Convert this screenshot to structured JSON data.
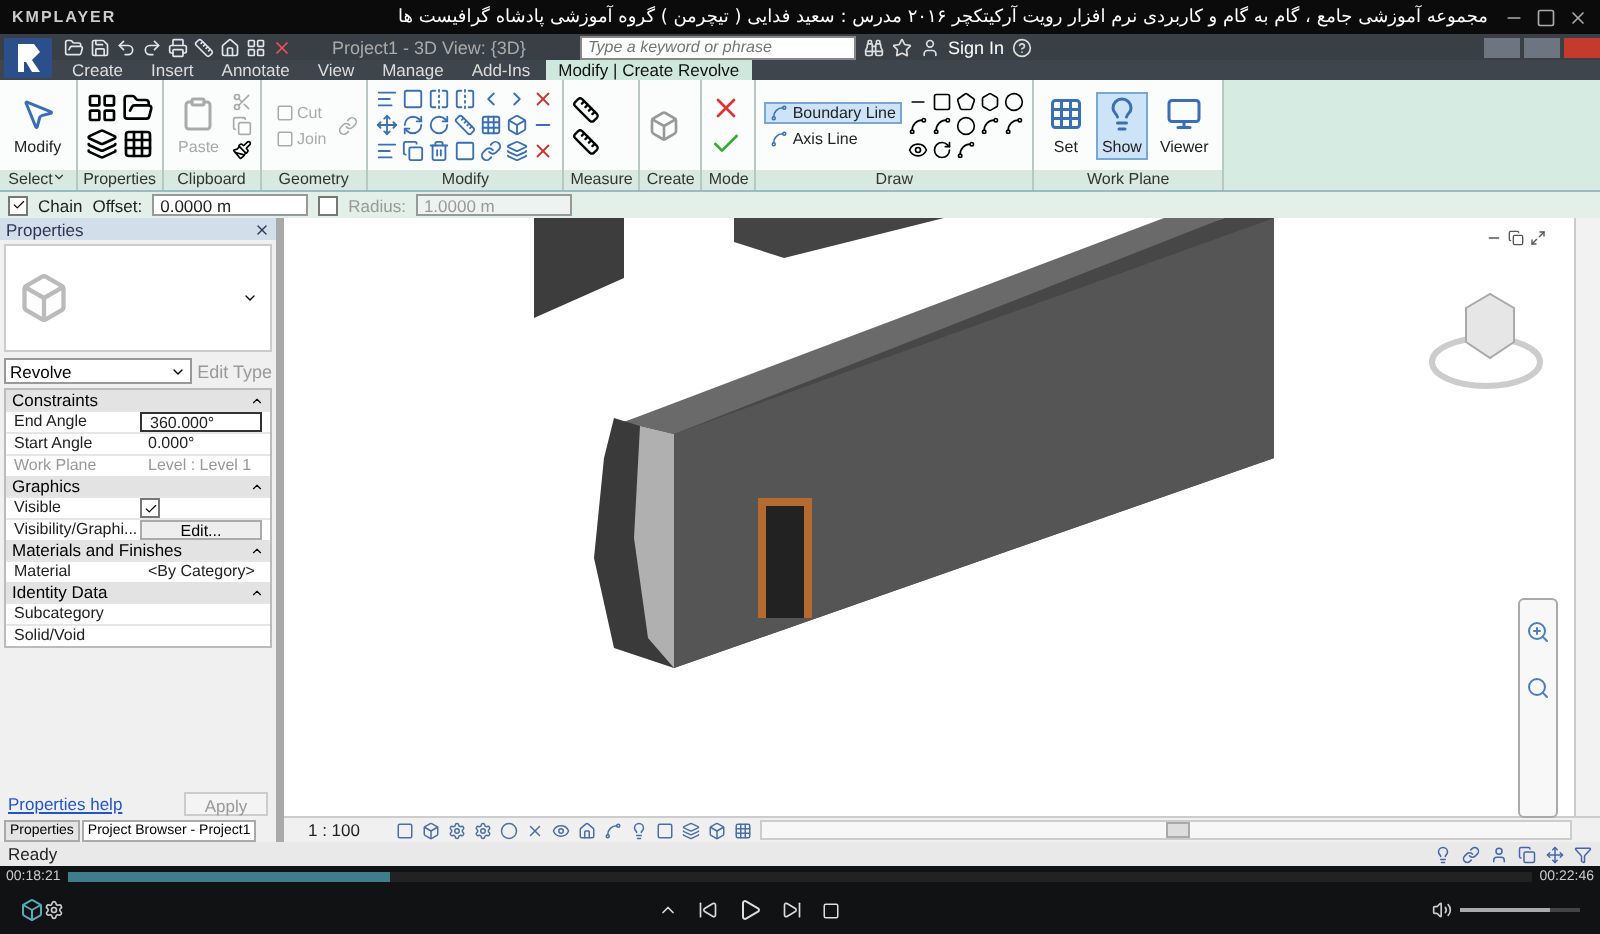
{
  "player": {
    "brand": "KMPLAYER",
    "title": "مجموعه آموزشی جامع ، گام به گام و کاربردی نرم افزار رویت آرکیتکچر ۲۰۱۶   مدرس : سعید فدایی ( تیچرمن ) گروه آموزشی پادشاه گرافیست ها",
    "elapsed": "00:18:21",
    "total": "00:22:46",
    "progress": {
      "level": 0.22
    },
    "volume": {
      "level": 0.75
    }
  },
  "revit": {
    "project_title": "Project1 - 3D View: {3D}",
    "search": {
      "placeholder": "Type a keyword or phrase"
    },
    "sign_in": "Sign In"
  },
  "tabs": [
    {
      "label": "Create",
      "selected": false
    },
    {
      "label": "Insert",
      "selected": false
    },
    {
      "label": "Annotate",
      "selected": false
    },
    {
      "label": "View",
      "selected": false
    },
    {
      "label": "Manage",
      "selected": false
    },
    {
      "label": "Add-Ins",
      "selected": false
    },
    {
      "label": "Modify | Create Revolve",
      "selected": true
    }
  ],
  "ribbon": [
    {
      "label": "Select",
      "dropdown": true,
      "tools": [
        {
          "label": "Modify",
          "kind": "large",
          "disabled": false,
          "selected": false
        }
      ]
    },
    {
      "label": "Properties",
      "dropdown": false
    },
    {
      "label": "Clipboard",
      "dropdown": false,
      "tools": [
        {
          "label": "Paste",
          "kind": "large",
          "disabled": true,
          "selected": false
        }
      ]
    },
    {
      "label": "Geometry",
      "dropdown": false,
      "tools": [
        {
          "label": "Cut",
          "kind": "small",
          "disabled": true,
          "selected": false
        },
        {
          "label": "Join",
          "kind": "small",
          "disabled": true,
          "selected": false
        }
      ]
    },
    {
      "label": "Modify",
      "dropdown": false
    },
    {
      "label": "Measure",
      "dropdown": false
    },
    {
      "label": "Create",
      "dropdown": false
    },
    {
      "label": "Mode",
      "dropdown": false
    },
    {
      "label": "Draw",
      "dropdown": false,
      "tools": [
        {
          "label": "Boundary Line",
          "kind": "small",
          "disabled": false,
          "selected": true
        },
        {
          "label": "Axis Line",
          "kind": "small",
          "disabled": false,
          "selected": false
        }
      ]
    },
    {
      "label": "Work Plane",
      "dropdown": false,
      "tools": [
        {
          "label": "Set",
          "kind": "large",
          "disabled": false,
          "selected": false
        },
        {
          "label": "Show",
          "kind": "large",
          "disabled": false,
          "selected": true
        },
        {
          "label": "Viewer",
          "kind": "large",
          "disabled": false,
          "selected": false
        }
      ]
    }
  ],
  "options_bar": {
    "chain": {
      "label": "Chain",
      "checked": true
    },
    "offset": {
      "label": "Offset:",
      "value": "0.0000 m"
    },
    "radius": {
      "label": "Radius:",
      "checked": false,
      "value": "1.0000 m"
    }
  },
  "properties": {
    "title": "Properties",
    "type_name": "Revolve",
    "edit_type": "Edit Type",
    "rows": [
      {
        "kind": "group",
        "label": "Constraints"
      },
      {
        "kind": "param",
        "label": "End Angle",
        "value": "360.000°",
        "disabled": false,
        "focused": true
      },
      {
        "kind": "param",
        "label": "Start Angle",
        "value": "0.000°",
        "disabled": false,
        "focused": false
      },
      {
        "kind": "param",
        "label": "Work Plane",
        "value": "Level : Level 1",
        "disabled": true,
        "focused": false
      },
      {
        "kind": "group",
        "label": "Graphics"
      },
      {
        "kind": "checkbox",
        "label": "Visible",
        "checked": true
      },
      {
        "kind": "button",
        "label": "Visibility/Graphi...",
        "value": "Edit..."
      },
      {
        "kind": "group",
        "label": "Materials and Finishes"
      },
      {
        "kind": "param",
        "label": "Material",
        "value": "<By Category>",
        "disabled": false,
        "focused": false
      },
      {
        "kind": "group",
        "label": "Identity Data"
      },
      {
        "kind": "param",
        "label": "Subcategory"
      },
      {
        "kind": "param",
        "label": "Solid/Void"
      }
    ],
    "help_link": "Properties help",
    "apply": "Apply",
    "bottom_tabs": [
      {
        "label": "Properties",
        "selected": false
      },
      {
        "label": "Project Browser - Project1",
        "selected": true
      }
    ]
  },
  "view": {
    "scale": "1 : 100"
  },
  "status_bar": {
    "text": "Ready"
  }
}
